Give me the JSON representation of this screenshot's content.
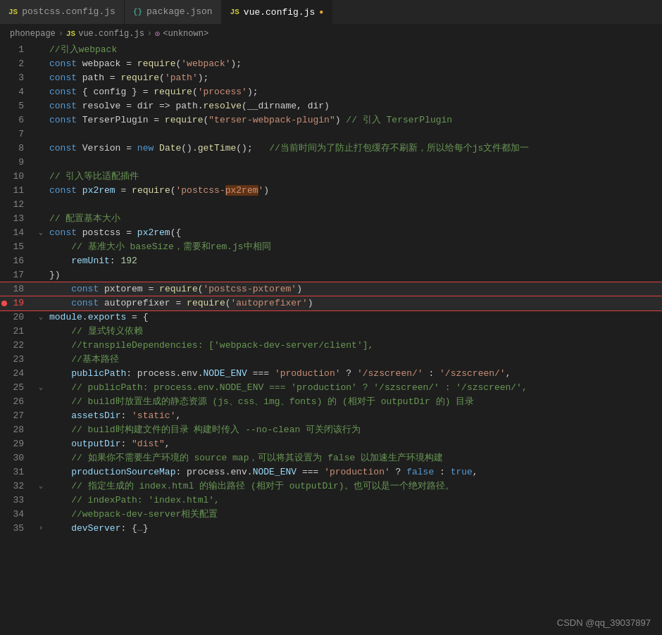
{
  "tabs": [
    {
      "id": "postcss",
      "icon": "js",
      "label": "postcss.config.js",
      "active": false
    },
    {
      "id": "package",
      "icon": "json",
      "label": "package.json",
      "active": false
    },
    {
      "id": "vue",
      "icon": "js",
      "label": "vue.config.js",
      "active": true,
      "modified": true
    }
  ],
  "breadcrumb": {
    "parts": [
      "phonepage",
      "vue.config.js",
      "<unknown>"
    ]
  },
  "lines": [
    {
      "num": 1,
      "content": "comment_webpack"
    },
    {
      "num": 2,
      "content": "const_webpack"
    },
    {
      "num": 3,
      "content": "const_path"
    },
    {
      "num": 4,
      "content": "const_config"
    },
    {
      "num": 5,
      "content": "const_resolve"
    },
    {
      "num": 6,
      "content": "const_terser"
    },
    {
      "num": 7,
      "content": "empty"
    },
    {
      "num": 8,
      "content": "const_version"
    },
    {
      "num": 9,
      "content": "empty"
    },
    {
      "num": 10,
      "content": "comment_plugins"
    },
    {
      "num": 11,
      "content": "const_px2rem"
    },
    {
      "num": 12,
      "content": "empty"
    },
    {
      "num": 13,
      "content": "comment_config"
    },
    {
      "num": 14,
      "content": "const_postcss_start",
      "collapse": true
    },
    {
      "num": 15,
      "content": "comment_basesize"
    },
    {
      "num": 16,
      "content": "remunit"
    },
    {
      "num": 17,
      "content": "close_brace"
    },
    {
      "num": 18,
      "content": "const_pxtorem",
      "boxed": true
    },
    {
      "num": 19,
      "content": "const_autoprefixer",
      "boxed": true,
      "error": true
    },
    {
      "num": 20,
      "content": "module_exports",
      "collapse": true
    },
    {
      "num": 21,
      "content": "comment_transpile"
    },
    {
      "num": 22,
      "content": "transpiledeps"
    },
    {
      "num": 23,
      "content": "comment_basepath"
    },
    {
      "num": 24,
      "content": "publicpath"
    },
    {
      "num": 25,
      "content": "comment_publicpath",
      "collapse": true
    },
    {
      "num": 26,
      "content": "comment_build"
    },
    {
      "num": 27,
      "content": "assetsdir"
    },
    {
      "num": 28,
      "content": "comment_outputdir"
    },
    {
      "num": 29,
      "content": "outputdir"
    },
    {
      "num": 30,
      "content": "comment_sourcemap"
    },
    {
      "num": 31,
      "content": "prodsourcemap"
    },
    {
      "num": 32,
      "content": "comment_indexpath",
      "collapse": true
    },
    {
      "num": 33,
      "content": "indexpath"
    },
    {
      "num": 34,
      "content": "comment_webpack2"
    },
    {
      "num": 35,
      "content": "devserver",
      "collapse": true
    }
  ],
  "watermark": "CSDN @qq_39037897"
}
